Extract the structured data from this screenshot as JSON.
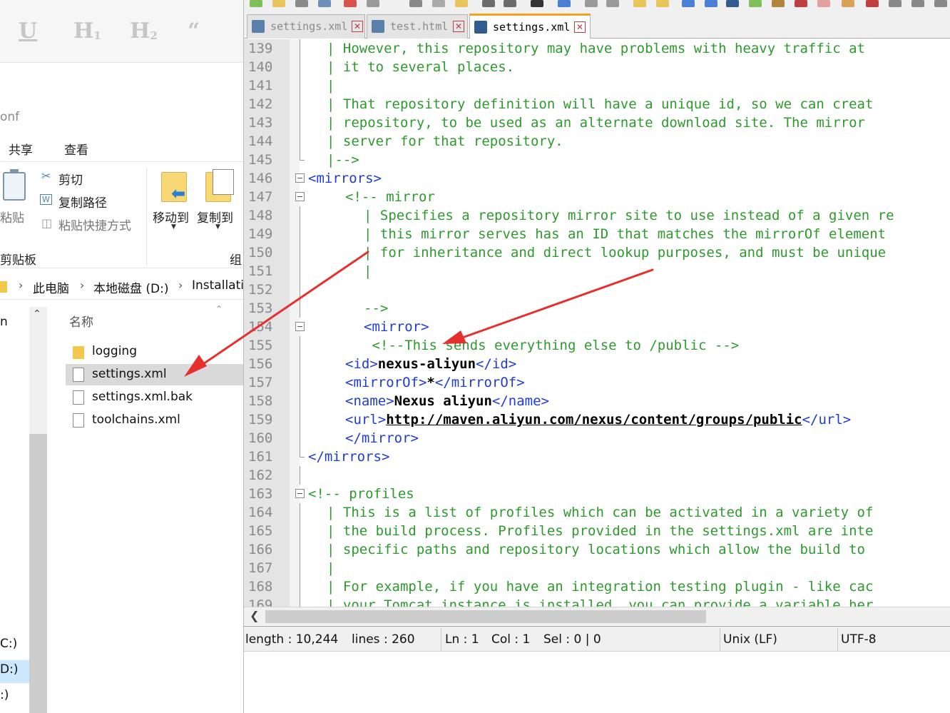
{
  "explorer": {
    "format_buttons": [
      "U",
      "H1",
      "H2",
      "66"
    ],
    "folder_label": "onf",
    "ribbon_tabs": [
      "共享",
      "查看"
    ],
    "clipboard": {
      "paste": "粘贴",
      "cut": "剪切",
      "copy_path": "复制路径",
      "paste_shortcut": "粘贴快捷方式",
      "group": "剪贴板"
    },
    "organize": {
      "move_to": "移动到",
      "copy_to": "复制到",
      "group": "组"
    },
    "breadcrumb": [
      "此电脑",
      "本地磁盘 (D:)",
      "Installati"
    ],
    "nav_items": [
      "C:)",
      "D:)",
      ":)"
    ],
    "column_header": "名称",
    "files": [
      {
        "name": "logging",
        "type": "folder"
      },
      {
        "name": "settings.xml",
        "type": "file"
      },
      {
        "name": "settings.xml.bak",
        "type": "file"
      },
      {
        "name": "toolchains.xml",
        "type": "file"
      }
    ]
  },
  "editor": {
    "tabs": [
      {
        "label": "settings.xml",
        "active": false
      },
      {
        "label": "test.html",
        "active": false
      },
      {
        "label": "settings.xml",
        "active": true
      }
    ],
    "lines": [
      {
        "n": "139",
        "parts": [
          [
            "c",
            "| However, this repository may have problems with heavy traffic at"
          ]
        ]
      },
      {
        "n": "140",
        "parts": [
          [
            "c",
            "| it to several places."
          ]
        ]
      },
      {
        "n": "141",
        "parts": [
          [
            "c",
            "|"
          ]
        ]
      },
      {
        "n": "142",
        "parts": [
          [
            "c",
            "| That repository definition will have a unique id, so we can creat"
          ]
        ]
      },
      {
        "n": "143",
        "parts": [
          [
            "c",
            "| repository, to be used as an alternate download site. The mirror"
          ]
        ]
      },
      {
        "n": "144",
        "parts": [
          [
            "c",
            "| server for that repository."
          ]
        ]
      },
      {
        "n": "145",
        "parts": [
          [
            "c",
            "|-->"
          ]
        ]
      },
      {
        "n": "146",
        "parts": [
          [
            "t",
            "<mirrors>"
          ]
        ],
        "indent": -1
      },
      {
        "n": "147",
        "parts": [
          [
            "c",
            "<!-- mirror"
          ]
        ],
        "indent": 1
      },
      {
        "n": "148",
        "parts": [
          [
            "c",
            "| Specifies a repository mirror site to use instead of a given re"
          ]
        ],
        "indent": 2
      },
      {
        "n": "149",
        "parts": [
          [
            "c",
            "| this mirror serves has an ID that matches the mirrorOf element"
          ]
        ],
        "indent": 2
      },
      {
        "n": "150",
        "parts": [
          [
            "c",
            "| for inheritance and direct lookup purposes, and must be unique"
          ]
        ],
        "indent": 2
      },
      {
        "n": "151",
        "parts": [
          [
            "c",
            "|"
          ]
        ],
        "indent": 2
      },
      {
        "n": "152",
        "parts": [
          [
            "c",
            ""
          ]
        ],
        "indent": 2
      },
      {
        "n": "153",
        "parts": [
          [
            "c",
            "-->"
          ]
        ],
        "indent": 2
      },
      {
        "n": "154",
        "parts": [
          [
            "t",
            "<mirror>"
          ]
        ],
        "indent": 2
      },
      {
        "n": "155",
        "parts": [
          [
            "c",
            " <!--This sends everything else to /public -->"
          ]
        ],
        "indent": 2
      },
      {
        "n": "156",
        "parts": [
          [
            "t",
            "<id>"
          ],
          [
            "b",
            "nexus-aliyun"
          ],
          [
            "t",
            "</id>"
          ]
        ],
        "indent": 1
      },
      {
        "n": "157",
        "parts": [
          [
            "t",
            "<mirrorOf>"
          ],
          [
            "b",
            "*"
          ],
          [
            "t",
            "</mirrorOf>"
          ]
        ],
        "indent": 1
      },
      {
        "n": "158",
        "parts": [
          [
            "t",
            "<name>"
          ],
          [
            "b",
            "Nexus aliyun"
          ],
          [
            "t",
            "</name>"
          ]
        ],
        "indent": 1
      },
      {
        "n": "159",
        "parts": [
          [
            "t",
            "<url>"
          ],
          [
            "u",
            "http://maven.aliyun.com/nexus/content/groups/public"
          ],
          [
            "t",
            "</url>"
          ]
        ],
        "indent": 1
      },
      {
        "n": "160",
        "parts": [
          [
            "t",
            "</mirror>"
          ]
        ],
        "indent": 1
      },
      {
        "n": "161",
        "parts": [
          [
            "t",
            "</mirrors>"
          ]
        ],
        "indent": -1
      },
      {
        "n": "162",
        "parts": [
          [
            "c",
            ""
          ]
        ]
      },
      {
        "n": "163",
        "parts": [
          [
            "c",
            "<!-- profiles"
          ]
        ],
        "indent": -1
      },
      {
        "n": "164",
        "parts": [
          [
            "c",
            "| This is a list of profiles which can be activated in a variety of"
          ]
        ]
      },
      {
        "n": "165",
        "parts": [
          [
            "c",
            "| the build process. Profiles provided in the settings.xml are inte"
          ]
        ]
      },
      {
        "n": "166",
        "parts": [
          [
            "c",
            "| specific paths and repository locations which allow the build to"
          ]
        ]
      },
      {
        "n": "167",
        "parts": [
          [
            "c",
            "|"
          ]
        ]
      },
      {
        "n": "168",
        "parts": [
          [
            "c",
            "| For example, if you have an integration testing plugin - like cac"
          ]
        ]
      },
      {
        "n": "169",
        "parts": [
          [
            "c",
            "| your Tomcat instance is installed, you can provide a variable her"
          ]
        ]
      }
    ]
  },
  "status": {
    "length": "length : 10,244",
    "lines": "lines : 260",
    "ln": "Ln : 1",
    "col": "Col : 1",
    "sel": "Sel : 0 | 0",
    "eol": "Unix (LF)",
    "encoding": "UTF-8"
  },
  "colors": {
    "comment": "#2e9a2e",
    "tag": "#1f3dd0",
    "annotation_arrow": "#e5302e",
    "tab_accent": "#f4a41c"
  }
}
